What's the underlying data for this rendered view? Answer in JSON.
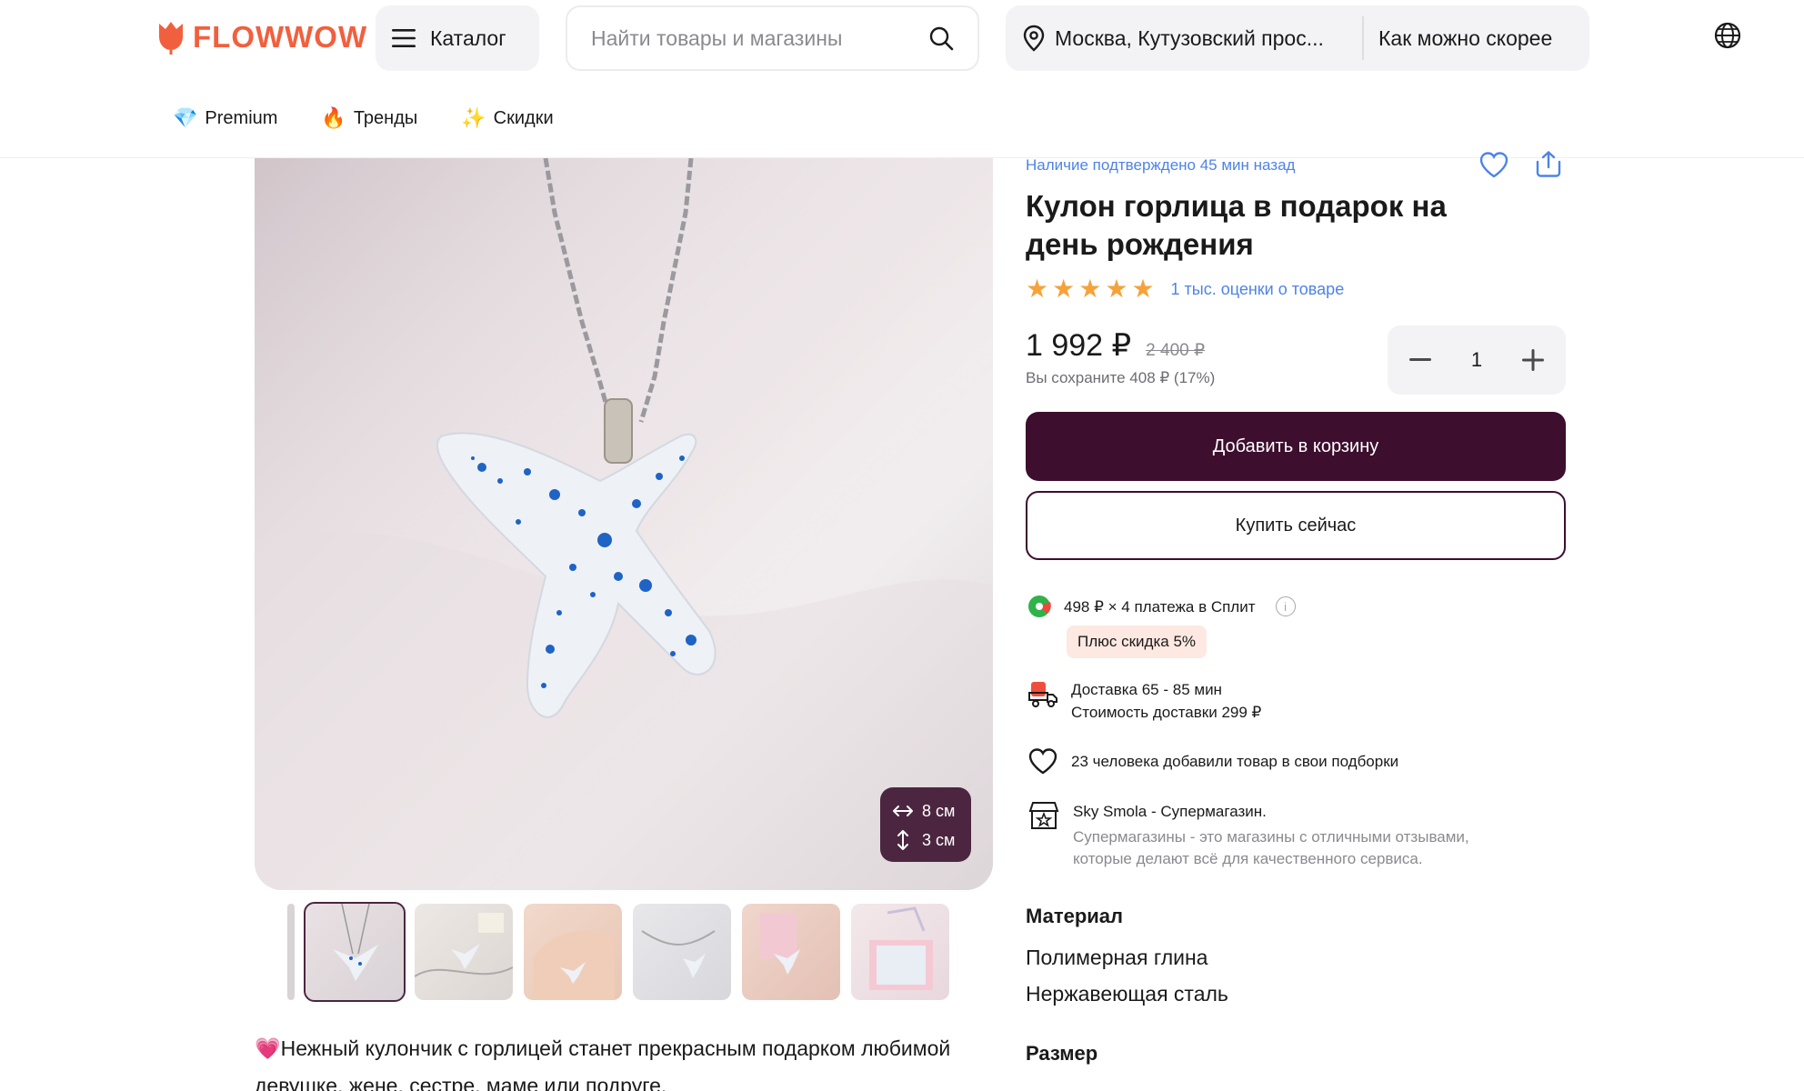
{
  "header": {
    "logo_text": "FLOWWOW",
    "catalog_label": "Каталог",
    "search_placeholder": "Найти товары и магазины",
    "address": "Москва, Кутузовский прос...",
    "delivery_time": "Как можно скорее"
  },
  "nav": [
    {
      "emoji": "💎",
      "label": "Premium"
    },
    {
      "emoji": "🔥",
      "label": "Тренды"
    },
    {
      "emoji": "✨",
      "label": "Скидки"
    }
  ],
  "gallery": {
    "width_label": "8 см",
    "height_label": "3 см",
    "thumbnails": [
      "thumb-1",
      "thumb-2",
      "thumb-3",
      "thumb-4",
      "thumb-5",
      "thumb-6"
    ]
  },
  "product": {
    "availability": "Наличие подтверждено 45 мин назад",
    "title": "Кулон горлица в подарок на день рождения",
    "rating_stars": 5,
    "rating_text": "1 тыс. оценки о товаре",
    "price": "1 992 ₽",
    "old_price": "2 400 ₽",
    "savings": "Вы сохраните 408 ₽ (17%)",
    "quantity": "1",
    "add_to_cart": "Добавить в корзину",
    "buy_now": "Купить сейчас"
  },
  "info": {
    "split_text": "498 ₽ × 4 платежа в Сплит",
    "split_badge": "Плюс скидка 5%",
    "delivery_line1": "Доставка 65 - 85 мин",
    "delivery_line2": "Стоимость доставки 299 ₽",
    "collections": "23 человека добавили товар в свои подборки",
    "shop_title": "Sky Smola - Супермагазин.",
    "shop_desc": "Супермагазины - это магазины с отличными отзывами, которые делают всё для качественного сервиса."
  },
  "specs": {
    "material_title": "Материал",
    "material_1": "Полимерная глина",
    "material_2": "Нержавеющая сталь",
    "size_title": "Размер"
  },
  "description": {
    "emoji": "💗",
    "text": "Нежный кулончик с горлицей станет прекрасным подарком любимой девушке, жене, сестре, маме или подруге."
  },
  "colors": {
    "brand": "#f1603e",
    "primary_button": "#3d0e2e",
    "link": "#4e83e8",
    "star": "#f6a23a"
  }
}
